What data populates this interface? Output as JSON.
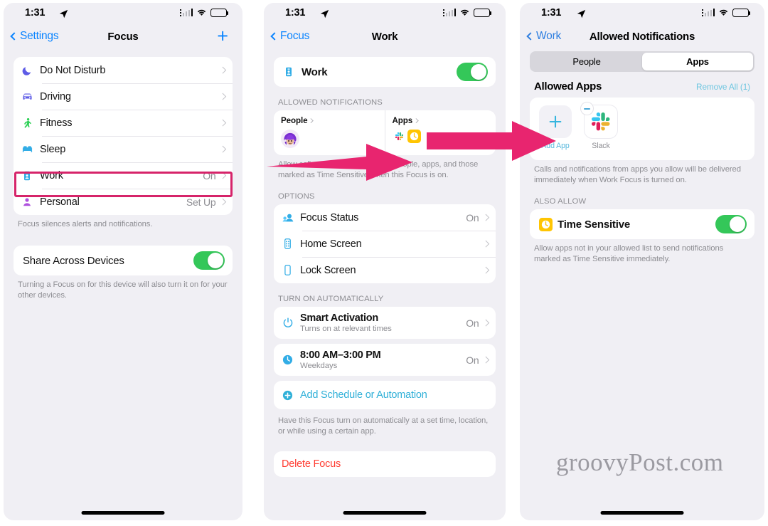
{
  "statusbar": {
    "time": "1:31",
    "location_icon": "location-arrow-icon",
    "wifi_icon": "wifi-icon",
    "battery_icon": "battery-icon"
  },
  "watermark": "groovyPost.com",
  "colors": {
    "accent_blue": "#0a84ff",
    "toggle_green": "#34c759",
    "highlight_pink": "#d6246a",
    "arrow_pink": "#e8256f",
    "teal_link": "#30b0d8",
    "destructive_red": "#ff3b30",
    "background": "#f0eff4"
  },
  "panel1": {
    "nav": {
      "back_label": "Settings",
      "title": "Focus",
      "add_label": "+"
    },
    "focus_items": [
      {
        "label": "Do Not Disturb",
        "value": "",
        "icon": "moon-icon"
      },
      {
        "label": "Driving",
        "value": "",
        "icon": "car-icon"
      },
      {
        "label": "Fitness",
        "value": "",
        "icon": "running-person-icon"
      },
      {
        "label": "Sleep",
        "value": "",
        "icon": "bed-icon"
      },
      {
        "label": "Work",
        "value": "On",
        "icon": "id-badge-icon"
      },
      {
        "label": "Personal",
        "value": "Set Up",
        "icon": "person-icon"
      }
    ],
    "footnote": "Focus silences alerts and notifications.",
    "share": {
      "label": "Share Across Devices",
      "state": "on"
    },
    "share_footnote": "Turning a Focus on for this device will also turn it on for your other devices."
  },
  "panel2": {
    "nav": {
      "back_label": "Focus",
      "title": "Work"
    },
    "work_toggle": {
      "label": "Work",
      "state": "on",
      "icon": "id-badge-icon"
    },
    "allowed_header": "ALLOWED NOTIFICATIONS",
    "people_card": {
      "label": "People",
      "avatar": "memoji-avatar"
    },
    "apps_card": {
      "label": "Apps",
      "icons": [
        "slack-icon",
        "clock-icon"
      ]
    },
    "allowed_footnote": "Allow calls and notifications from people, apps, and those marked as Time Sensitive when this Focus is on.",
    "options_header": "OPTIONS",
    "options": [
      {
        "label": "Focus Status",
        "value": "On",
        "icon": "focus-status-icon"
      },
      {
        "label": "Home Screen",
        "value": "",
        "icon": "home-screen-icon"
      },
      {
        "label": "Lock Screen",
        "value": "",
        "icon": "lock-screen-icon"
      }
    ],
    "auto_header": "TURN ON AUTOMATICALLY",
    "automations": [
      {
        "title": "Smart Activation",
        "subtitle": "Turns on at relevant times",
        "value": "On",
        "icon": "power-icon"
      },
      {
        "title": "8:00 AM–3:00 PM",
        "subtitle": "Weekdays",
        "value": "On",
        "icon": "clock-filled-icon"
      }
    ],
    "add_schedule": {
      "label": "Add Schedule or Automation",
      "icon": "plus-circle-icon"
    },
    "auto_footnote": "Have this Focus turn on automatically at a set time, location, or while using a certain app.",
    "delete": {
      "label": "Delete Focus"
    }
  },
  "panel3": {
    "nav": {
      "back_label": "Work",
      "title": "Allowed Notifications"
    },
    "segments": [
      {
        "label": "People",
        "active": false
      },
      {
        "label": "Apps",
        "active": true
      }
    ],
    "section": {
      "title": "Allowed Apps",
      "action": "Remove All (1)"
    },
    "apps": [
      {
        "label": "Add App",
        "type": "add",
        "icon": "plus-icon"
      },
      {
        "label": "Slack",
        "type": "app",
        "icon": "slack-icon",
        "removable": true
      }
    ],
    "apps_footnote": "Calls and notifications from apps you allow will be delivered immediately when Work Focus is turned on.",
    "also_header": "ALSO ALLOW",
    "time_sensitive": {
      "label": "Time Sensitive",
      "state": "on",
      "icon": "clock-icon"
    },
    "time_footnote": "Allow apps not in your allowed list to send notifications marked as Time Sensitive immediately."
  }
}
